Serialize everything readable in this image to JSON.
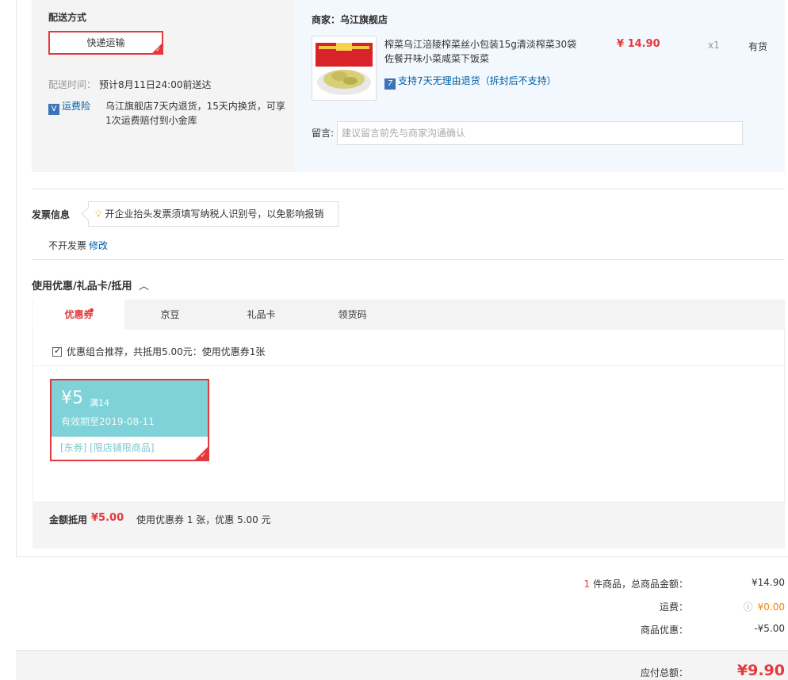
{
  "delivery": {
    "section_title": "配送方式",
    "method": "快递运输",
    "time_label": "配送时间：",
    "time_value": "预计8月11日24:00前送达",
    "insurance_icon": "V",
    "insurance_label": "运费险",
    "insurance_desc_1": "乌江旗舰店7天内退货，15天内换货，可享",
    "insurance_desc_2": "1次运费赔付到小金库"
  },
  "shop": {
    "label": "商家：乌江旗舰店",
    "product_title_1": "榨菜乌江涪陵榨菜丝小包装15g清淡榨菜30袋",
    "product_title_2": "佐餐开味小菜咸菜下饭菜",
    "price": "¥ 14.90",
    "qty": "x1",
    "stock": "有货",
    "return_icon": "7",
    "return_policy": "支持7天无理由退货（拆封后不支持）",
    "message_label": "留言:",
    "message_placeholder": "建议留言前先与商家沟通确认"
  },
  "invoice": {
    "title": "发票信息",
    "tip": "开企业抬头发票须填写纳税人识别号，以免影响报销",
    "status": "不开发票",
    "edit": "修改"
  },
  "discount": {
    "title": "使用优惠/礼品卡/抵用",
    "tabs": [
      "优惠券",
      "京豆",
      "礼品卡",
      "领货码"
    ],
    "combo_text": "优惠组合推荐，共抵用5.00元：使用优惠券1张",
    "coupon": {
      "amount": "¥5",
      "condition": "满14",
      "valid": "有效期至2019-08-11",
      "tags": "[东券]  [限店铺限商品]"
    },
    "summary_label": "金额抵用",
    "summary_amount": "¥5.00",
    "summary_desc": "使用优惠券 1 张，优惠 5.00 元"
  },
  "totals": {
    "count": "1",
    "count_suffix": " 件商品，总商品金额：",
    "goods_total": "¥14.90",
    "shipping_label": "运费：",
    "shipping_value": "¥0.00",
    "discount_label": "商品优惠：",
    "discount_value": "-¥5.00",
    "pay_label": "应付总额：",
    "pay_value": "¥9.90"
  }
}
